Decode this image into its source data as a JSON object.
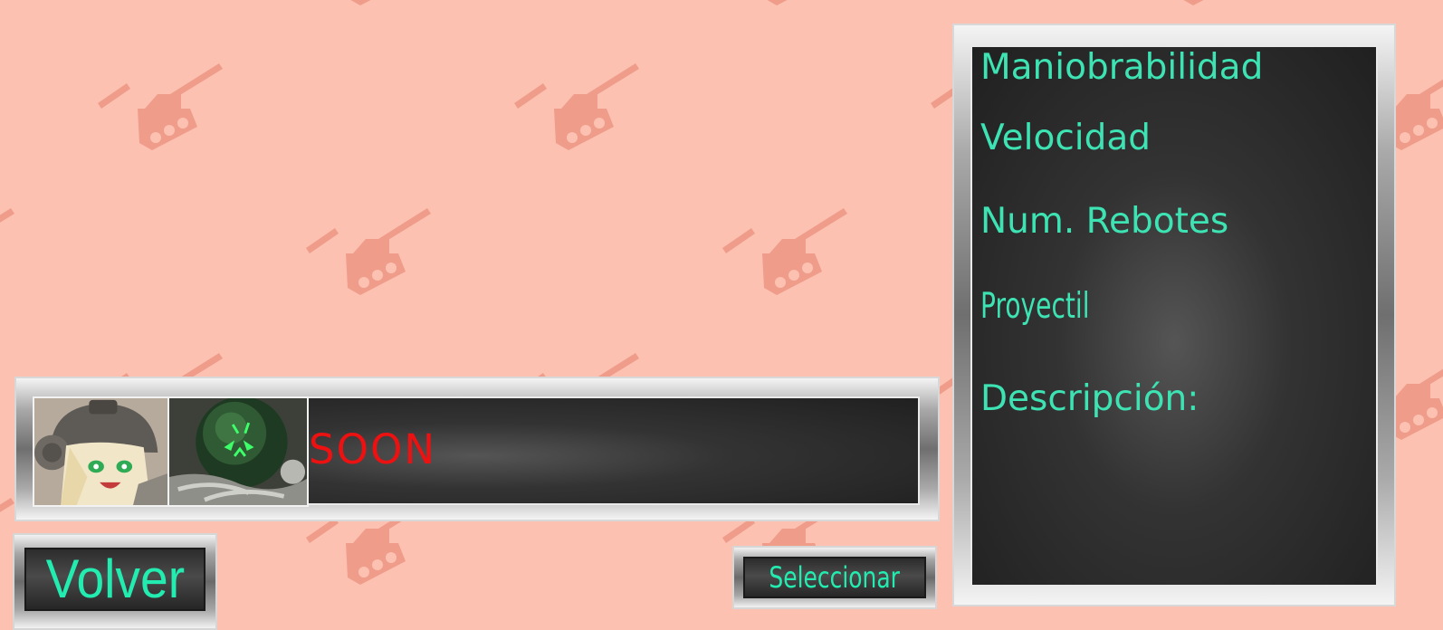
{
  "stats_panel": {
    "maniobrabilidad_label": "Maniobrabilidad",
    "velocidad_label": "Velocidad",
    "rebotes_label": "Num. Rebotes",
    "proyectil_label": "Proyectil",
    "descripcion_label": "Descripción:"
  },
  "tank_selector": {
    "soon_label": "SOON"
  },
  "buttons": {
    "volver_label": "Volver",
    "seleccionar_label": "Seleccionar"
  },
  "colors": {
    "background": "#fcc1b0",
    "pattern": "#ef9c8b",
    "stat_text": "#3de3b3",
    "button_text": "#22ecb0",
    "soon_text": "#ee1111"
  },
  "icons": {
    "background_pattern": "tank-icon",
    "portrait_1": "tank-girl-character-icon",
    "portrait_2": "green-orb-tank-character-icon"
  }
}
